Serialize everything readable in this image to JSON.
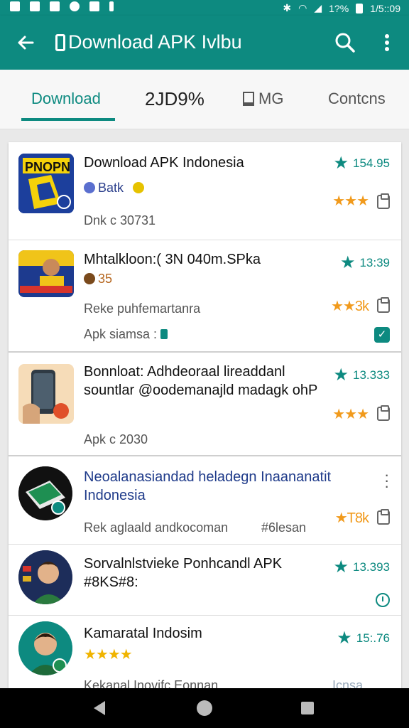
{
  "status_bar": {
    "battery": "1?%",
    "time": "1/5::09"
  },
  "app_bar": {
    "title": "Download APK Ivlbu"
  },
  "tabs": [
    {
      "label": "Download"
    },
    {
      "label": "2JD9%"
    },
    {
      "label": "MG"
    },
    {
      "label": "Contcns"
    }
  ],
  "items": [
    {
      "title": "Download APK Indonesia",
      "sub1": "Batk",
      "sub2": "Dnk c 30731",
      "rating": "154.95",
      "stars": "★★★"
    },
    {
      "title": "Mhtalkloon:( 3N 040m.SPka",
      "sub1": "35",
      "sub2": "Reke puhfemartanra",
      "sub3": "Apk siamsa :",
      "rating": "13:39",
      "stars": "★★3k"
    },
    {
      "title": "Bonnloat: Adhdeoraal lireaddanl sountlar @oodemanajld madagk ohP",
      "sub2": "Apk c 2030",
      "rating": "13.333",
      "stars": "★★★"
    },
    {
      "title": "Neoalanasiandad heladegn Inaananatit Indonesia",
      "sub2": "Rek aglaald andkocoman",
      "sub2b": "#6lesan",
      "stars": "★T8k"
    },
    {
      "title": "Sorvalnlstvieke Ponhcandl APK #8KS#8:",
      "rating": "13.393"
    },
    {
      "title": "Kamaratal Indosim",
      "sub2": "Kekanal Inovifc Eonnan",
      "sub2b": "Icnsa",
      "rating": "15:.76",
      "stars": "★★★★"
    }
  ]
}
